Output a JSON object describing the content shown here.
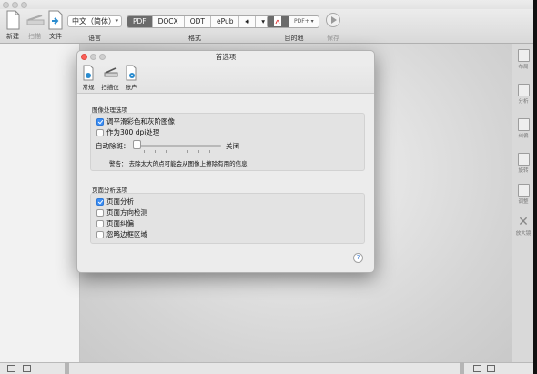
{
  "toolbar": {
    "new": "新建",
    "scan": "扫描",
    "file": "文件",
    "language_value": "中文（简体）",
    "language_label": "语言",
    "formats": [
      "PDF",
      "DOCX",
      "ODT",
      "ePub"
    ],
    "format_selected": "PDF",
    "format_label": "格式",
    "destination_value": "PDF+",
    "destination_label": "目的地",
    "save": "保存"
  },
  "sidebar_right": {
    "items": [
      "布局",
      "分析",
      "纠偏",
      "旋转",
      "调整",
      "放大镜"
    ]
  },
  "dialog": {
    "title": "首选项",
    "tabs": [
      "常规",
      "扫描仪",
      "账户"
    ],
    "image_section": {
      "title": "图像处理选项",
      "smooth": "调平滑彩色和灰阶图像",
      "smooth_checked": true,
      "dpi300": "作为300 dpi处理",
      "dpi300_checked": false,
      "despeckle_label": "自动除斑：",
      "despeckle_value": "关闭",
      "warning": "警告：  去除太大的点可能会从图像上擦除有用的信息"
    },
    "page_section": {
      "title": "页面分析选项",
      "options": [
        {
          "label": "页面分析",
          "checked": true
        },
        {
          "label": "页面方向检测",
          "checked": false
        },
        {
          "label": "页面纠偏",
          "checked": false
        },
        {
          "label": "忽略边框区域",
          "checked": false
        }
      ]
    },
    "help": "?"
  }
}
